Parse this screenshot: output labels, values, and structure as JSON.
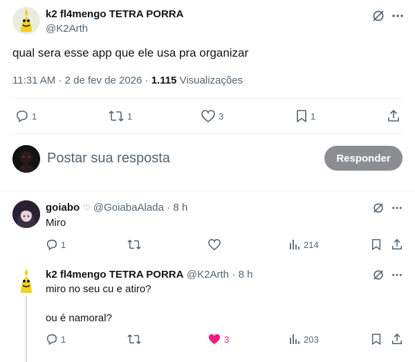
{
  "main_tweet": {
    "author_name": "k2 fl4mengo TETRA PORRA",
    "author_handle": "@K2Arth",
    "text": "qual sera esse app que ele usa pra organizar",
    "time": "11:31 AM",
    "dot": "·",
    "date": "2 de fev de 2026",
    "views_count": "1.115",
    "views_label": "Visualizações",
    "actions": {
      "replies": "1",
      "retweets": "1",
      "likes": "3",
      "bookmarks": "1"
    }
  },
  "reply_box": {
    "placeholder": "Postar sua resposta",
    "button_label": "Responder"
  },
  "replies": [
    {
      "author_name": "goiabo",
      "author_heart": "♡",
      "author_handle": "@GoiabaAlada",
      "time": "· 8 h",
      "text": "Miro",
      "replies": "1",
      "retweets": "",
      "likes": "",
      "views": "214"
    },
    {
      "author_name": "k2 fl4mengo TETRA PORRA",
      "author_handle": "@K2Arth",
      "time": "· 8 h",
      "text_line1": "miro no seu cu e atiro?",
      "text_line2": "ou é namoral?",
      "replies": "1",
      "retweets": "",
      "likes": "3",
      "views": "203"
    }
  ],
  "colors": {
    "text": "#0f1419",
    "muted": "#536471",
    "divider": "#eff3f4",
    "like": "#f91880",
    "reply_button": "#8b8d90"
  },
  "icons": [
    "grok-icon",
    "more-icon",
    "reply-icon",
    "retweet-icon",
    "like-icon",
    "bookmark-icon",
    "share-icon",
    "views-icon"
  ]
}
